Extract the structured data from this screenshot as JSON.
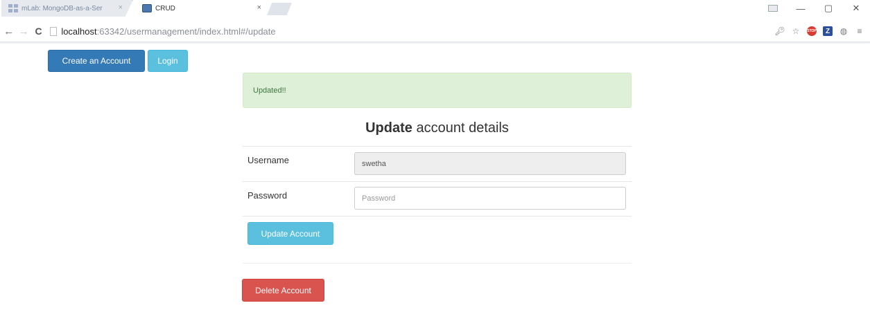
{
  "browser": {
    "tabs": [
      {
        "label": "mLab: MongoDB-as-a-Ser",
        "active": false
      },
      {
        "label": "CRUD",
        "active": true
      }
    ],
    "close_glyph": "×",
    "url_host": "localhost",
    "url_path": ":63342/usermanagement/index.html#/update",
    "window_controls": {
      "minimize": "—",
      "restore": "▢",
      "close": "✕"
    },
    "icons": [
      "back-arrow-icon",
      "forward-arrow-icon",
      "reload-icon",
      "page-icon",
      "key-icon",
      "star-icon",
      "stop-extension-icon",
      "z-extension-icon",
      "extension-icon",
      "menu-icon"
    ]
  },
  "nav": {
    "create_label": "Create an Account",
    "login_label": "Login"
  },
  "alert": {
    "message": "Updated!!",
    "color": "#dff0d8"
  },
  "form": {
    "heading_bold": "Update",
    "heading_rest": " account details",
    "username_label": "Username",
    "username_value": "swetha",
    "password_label": "Password",
    "password_placeholder": "Password",
    "password_value": "",
    "update_label": "Update Account"
  },
  "danger": {
    "delete_label": "Delete Account"
  },
  "colors": {
    "primary": "#337ab7",
    "info": "#5bc0de",
    "danger": "#d9534f"
  }
}
